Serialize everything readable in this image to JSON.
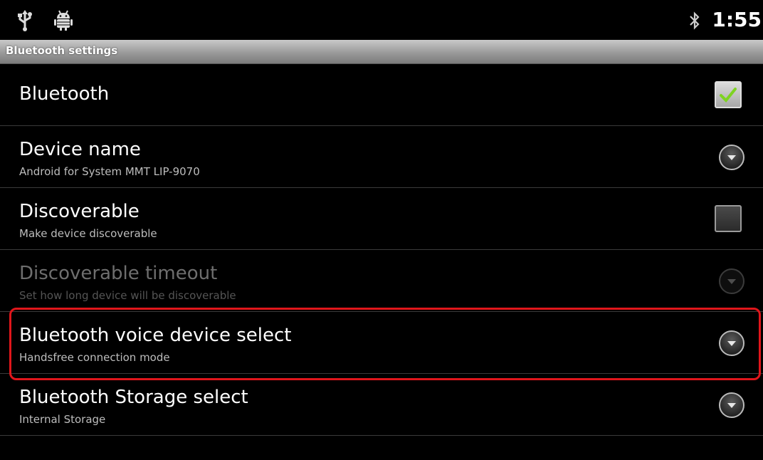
{
  "status_bar": {
    "icons": [
      "usb-icon",
      "android-debug-icon",
      "bluetooth-icon"
    ],
    "time": "1:55"
  },
  "title_bar": {
    "title": "Bluetooth settings"
  },
  "preferences": [
    {
      "title": "Bluetooth",
      "summary": "",
      "widget": "checkbox",
      "checked": true,
      "enabled": true
    },
    {
      "title": "Device name",
      "summary": "Android for System MMT LIP-9070",
      "widget": "dropdown",
      "enabled": true
    },
    {
      "title": "Discoverable",
      "summary": "Make device discoverable",
      "widget": "checkbox",
      "checked": false,
      "enabled": true
    },
    {
      "title": "Discoverable timeout",
      "summary": "Set how long device will be discoverable",
      "widget": "dropdown",
      "enabled": false
    },
    {
      "title": "Bluetooth voice device select",
      "summary": "Handsfree connection mode",
      "widget": "dropdown",
      "enabled": true,
      "highlighted": true
    },
    {
      "title": "Bluetooth Storage select",
      "summary": "Internal Storage",
      "widget": "dropdown",
      "enabled": true
    }
  ],
  "colors": {
    "highlight": "#e0161b",
    "check": "#7ed321",
    "background": "#000000"
  }
}
